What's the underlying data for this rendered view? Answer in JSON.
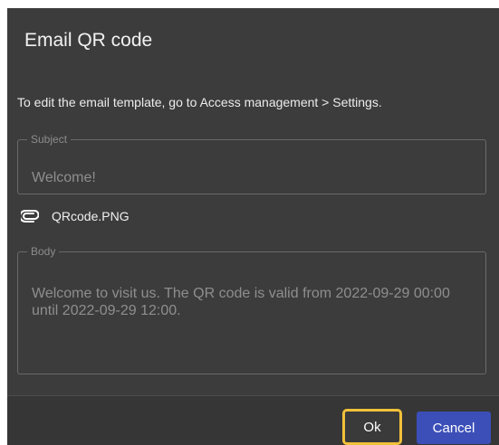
{
  "dialog": {
    "title": "Email QR code",
    "instructions": "To edit the email template, go to Access management > Settings.",
    "subject": {
      "legend": "Subject",
      "value": "Welcome!"
    },
    "attachment": {
      "icon": "paperclip-icon",
      "filename": "QRcode.PNG"
    },
    "body": {
      "legend": "Body",
      "value": "Welcome to visit us. The QR code is valid from 2022-09-29 00:00 until 2022-09-29 12:00."
    },
    "buttons": {
      "ok_label": "Ok",
      "cancel_label": "Cancel"
    }
  },
  "colors": {
    "dialog_background": "#3c3c3c",
    "footer_background": "#363636",
    "ok_highlight": "#f2c13a",
    "cancel_background": "#3c4fb8"
  }
}
